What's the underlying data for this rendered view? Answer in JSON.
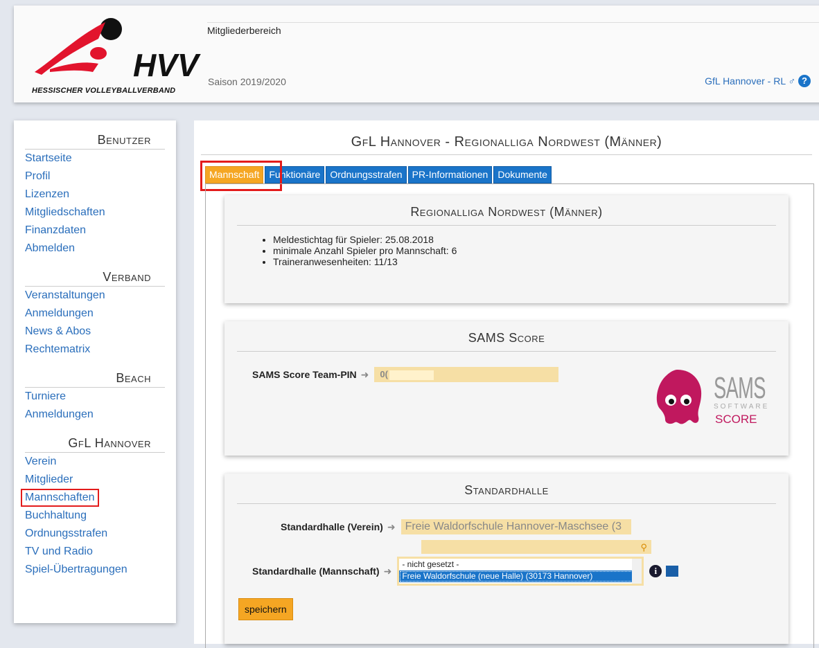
{
  "header": {
    "logo_abbr": "HVV",
    "logo_full": "HESSISCHER VOLLEYBALLVERBAND",
    "area_title": "Mitgliederbereich",
    "season": "Saison 2019/2020",
    "team": "GfL Hannover - RL ♂",
    "help": "?"
  },
  "sidebar": {
    "sections": [
      {
        "title": "Benutzer",
        "items": [
          "Startseite",
          "Profil",
          "Lizenzen",
          "Mitgliedschaften",
          "Finanzdaten",
          "Abmelden"
        ]
      },
      {
        "title": "Verband",
        "items": [
          "Veranstaltungen",
          "Anmeldungen",
          "News & Abos",
          "Rechtematrix"
        ]
      },
      {
        "title": "Beach",
        "items": [
          "Turniere",
          "Anmeldungen"
        ]
      },
      {
        "title": "GfL Hannover",
        "items": [
          "Verein",
          "Mitglieder",
          "Mannschaften",
          "Buchhaltung",
          "Ordnungsstrafen",
          "TV und Radio",
          "Spiel-Übertragungen"
        ]
      }
    ]
  },
  "main": {
    "title": "GfL Hannover - Regionalliga Nordwest (Männer)",
    "tabs": [
      "Mannschaft",
      "Funktionäre",
      "Ordnungsstrafen",
      "PR-Informationen",
      "Dokumente"
    ],
    "active_tab": "Mannschaft"
  },
  "league_card": {
    "title": "Regionalliga Nordwest (Männer)",
    "bullets": [
      "Meldestichtag für Spieler: 25.08.2018",
      "minimale Anzahl Spieler pro Mannschaft: 6",
      "Traineranwesenheiten: 11/13"
    ]
  },
  "sams_card": {
    "title": "SAMS Score",
    "pin_label": "SAMS Score Team-PIN",
    "arrow": "➜",
    "pin_value": "0(",
    "logo_text": "SAMS",
    "logo_sub": "SOFTWARE",
    "logo_score": "SCORE"
  },
  "hall_card": {
    "title": "Standardhalle",
    "verein_label": "Standardhalle (Verein)",
    "verein_value": "Freie Waldorfschule Hannover-Maschsee (3",
    "mannschaft_label": "Standardhalle (Mannschaft)",
    "options": [
      "- nicht gesetzt -",
      "Freie Waldorfschule (neue Halle) (30173 Hannover)"
    ],
    "selected_index": 1,
    "info": "i",
    "save_label": "speichern"
  },
  "colors": {
    "accent_orange": "#f5a623",
    "link_blue": "#2a6ebb",
    "tab_blue": "#1a74c9",
    "highlight_red": "#e31b1b",
    "field_yellow": "#f6dfa5",
    "sams_pink": "#c0185e"
  }
}
